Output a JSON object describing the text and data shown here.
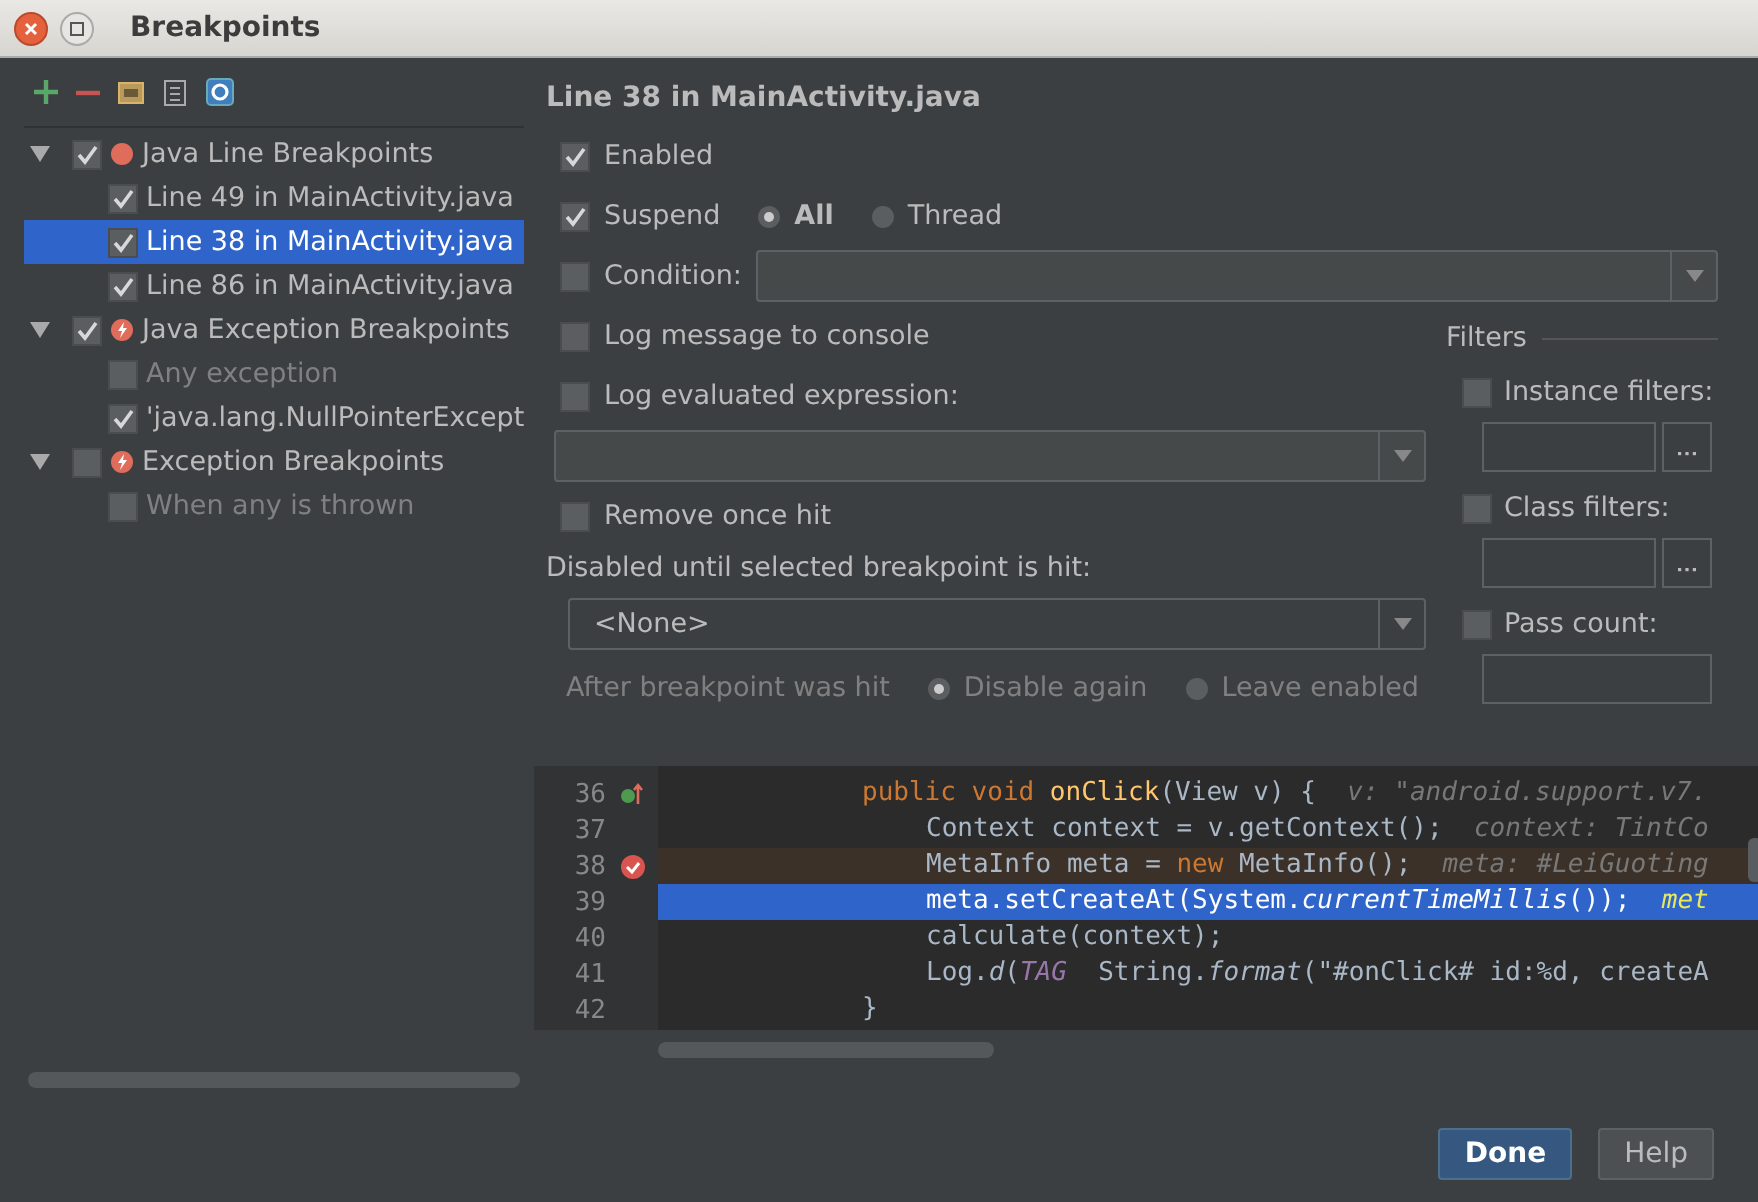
{
  "window": {
    "title": "Breakpoints"
  },
  "tree": [
    {
      "label": "Java Line Breakpoints",
      "kind": "line",
      "expanded": true,
      "checked": true,
      "selected": false,
      "children": [
        {
          "label": "Line 49 in MainActivity.java",
          "checked": true,
          "selected": false,
          "disabled": false
        },
        {
          "label": "Line 38 in MainActivity.java",
          "checked": true,
          "selected": true,
          "disabled": false
        },
        {
          "label": "Line 86 in MainActivity.java",
          "checked": true,
          "selected": false,
          "disabled": false
        }
      ]
    },
    {
      "label": "Java Exception Breakpoints",
      "kind": "exception",
      "expanded": true,
      "checked": true,
      "selected": false,
      "children": [
        {
          "label": "Any exception",
          "checked": false,
          "selected": false,
          "disabled": true
        },
        {
          "label": "'java.lang.NullPointerExcept",
          "checked": true,
          "selected": false,
          "disabled": false
        }
      ]
    },
    {
      "label": "Exception Breakpoints",
      "kind": "exception",
      "expanded": true,
      "checked": false,
      "selected": false,
      "children": [
        {
          "label": "When any is thrown",
          "checked": false,
          "selected": false,
          "disabled": true
        }
      ]
    }
  ],
  "detail": {
    "title": "Line 38 in MainActivity.java",
    "enabled": {
      "label": "Enabled",
      "checked": true
    },
    "suspend": {
      "label": "Suspend",
      "checked": true,
      "options": [
        {
          "label": "All",
          "selected": true
        },
        {
          "label": "Thread",
          "selected": false
        }
      ]
    },
    "condition": {
      "label": "Condition:",
      "checked": false
    },
    "log_message": {
      "label": "Log message to console",
      "checked": false
    },
    "log_expression": {
      "label": "Log evaluated expression:",
      "checked": false
    },
    "remove_once_hit": {
      "label": "Remove once hit",
      "checked": false
    },
    "disabled_until": {
      "label": "Disabled until selected breakpoint is hit:",
      "value": "<None>"
    },
    "after_hit": {
      "label": "After breakpoint was hit",
      "disabled": true,
      "options": [
        {
          "label": "Disable again",
          "selected": true
        },
        {
          "label": "Leave enabled",
          "selected": false
        }
      ]
    }
  },
  "filters": {
    "title": "Filters",
    "items": [
      {
        "label": "Instance filters:",
        "checked": false,
        "kind": "browse"
      },
      {
        "label": "Class filters:",
        "checked": false,
        "kind": "browse"
      },
      {
        "label": "Pass count:",
        "checked": false,
        "kind": "plain"
      }
    ]
  },
  "editor": {
    "lines": [
      {
        "number": "36",
        "overrides": true,
        "has_breakpoint": false,
        "execution_point": false,
        "nested": false,
        "segments": [
          {
            "kind": "keyword",
            "text": "public void "
          },
          {
            "kind": "method",
            "text": "onClick"
          },
          {
            "kind": "plain",
            "text": "(View v) {  "
          },
          {
            "kind": "hint",
            "text": "v: \"android.support.v7."
          }
        ]
      },
      {
        "number": "37",
        "overrides": false,
        "has_breakpoint": false,
        "execution_point": false,
        "nested": true,
        "segments": [
          {
            "kind": "plain",
            "text": "Context context = v.getContext();  "
          },
          {
            "kind": "hint",
            "text": "context: TintCo"
          }
        ]
      },
      {
        "number": "38",
        "overrides": false,
        "has_breakpoint": true,
        "execution_point": false,
        "nested": true,
        "segments": [
          {
            "kind": "plain",
            "text": "MetaInfo meta = "
          },
          {
            "kind": "keyword",
            "text": "new "
          },
          {
            "kind": "plain",
            "text": "MetaInfo();  "
          },
          {
            "kind": "hint",
            "text": "meta: #LeiGuoting"
          }
        ]
      },
      {
        "number": "39",
        "overrides": false,
        "has_breakpoint": false,
        "execution_point": true,
        "nested": true,
        "segments": [
          {
            "kind": "plain",
            "text": "meta.setCreateAt(System."
          },
          {
            "kind": "italic",
            "text": "currentTimeMillis"
          },
          {
            "kind": "plain",
            "text": "());  "
          },
          {
            "kind": "current_hint",
            "text": "met"
          }
        ]
      },
      {
        "number": "40",
        "overrides": false,
        "has_breakpoint": false,
        "execution_point": false,
        "nested": true,
        "segments": [
          {
            "kind": "plain",
            "text": "calculate(context);"
          }
        ]
      },
      {
        "number": "41",
        "overrides": false,
        "has_breakpoint": false,
        "execution_point": false,
        "nested": true,
        "segments": [
          {
            "kind": "plain",
            "text": "Log."
          },
          {
            "kind": "italic",
            "text": "d"
          },
          {
            "kind": "plain",
            "text": "("
          },
          {
            "kind": "constant",
            "text": "TAG"
          },
          {
            "kind": "plain",
            "text": "  String."
          },
          {
            "kind": "italic",
            "text": "format"
          },
          {
            "kind": "plain",
            "text": "(\"#onClick# id:%d, createA"
          }
        ]
      },
      {
        "number": "42",
        "overrides": false,
        "has_breakpoint": false,
        "execution_point": false,
        "nested": false,
        "segments": [
          {
            "kind": "plain",
            "text": "}"
          }
        ]
      }
    ]
  },
  "buttons": [
    {
      "label": "Done",
      "default": true
    },
    {
      "label": "Help",
      "default": false
    }
  ]
}
